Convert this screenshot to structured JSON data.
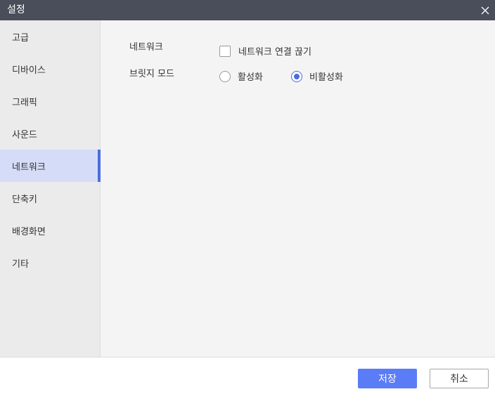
{
  "window": {
    "title": "설정",
    "close_icon": "close-icon"
  },
  "sidebar": {
    "items": [
      {
        "label": "고급"
      },
      {
        "label": "디바이스"
      },
      {
        "label": "그래픽"
      },
      {
        "label": "사운드"
      },
      {
        "label": "네트워크",
        "active": true
      },
      {
        "label": "단축키"
      },
      {
        "label": "배경화면"
      },
      {
        "label": "기타"
      }
    ]
  },
  "network": {
    "label": "네트워크",
    "disconnect_label": "네트워크 연결 끊기",
    "disconnect_checked": false
  },
  "bridge_mode": {
    "label": "브릿지 모드",
    "options": [
      {
        "label": "활성화",
        "selected": false
      },
      {
        "label": "비활성화",
        "selected": true
      }
    ]
  },
  "footer": {
    "save_label": "저장",
    "cancel_label": "취소"
  },
  "colors": {
    "accent": "#4a6ee0",
    "primary_button": "#5b7cf7",
    "titlebar": "#4a4e5a",
    "active_item_bg": "#d4dcf7"
  }
}
